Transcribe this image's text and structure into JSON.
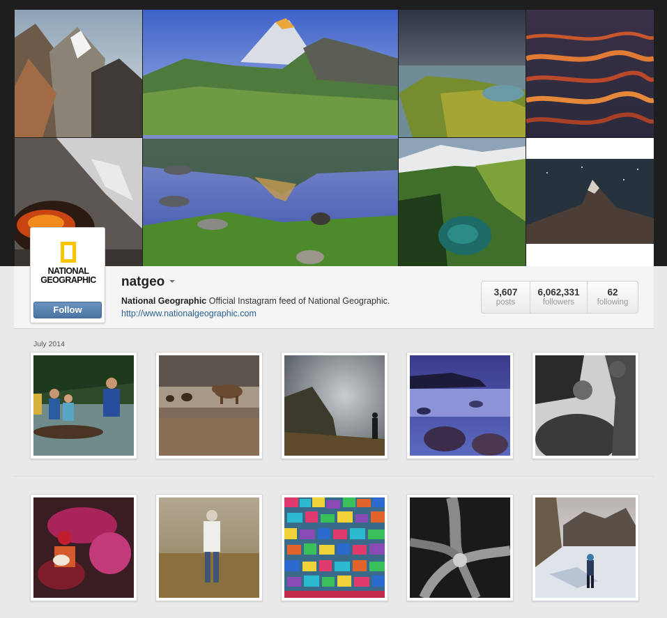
{
  "profile": {
    "username": "natgeo",
    "full_name": "National Geographic",
    "bio": "Official Instagram feed of National Geographic.",
    "website": "http://www.nationalgeographic.com",
    "follow_label": "Follow",
    "avatar_logo_line1": "NATIONAL",
    "avatar_logo_line2": "GEOGRAPHIC",
    "brand_yellow": "#f7c600",
    "follow_color": "#4a74a4"
  },
  "stats": [
    {
      "value": "3,607",
      "label": "posts"
    },
    {
      "value": "6,062,331",
      "label": "followers"
    },
    {
      "value": "62",
      "label": "following"
    }
  ],
  "feed": {
    "month_label": "July 2014"
  }
}
